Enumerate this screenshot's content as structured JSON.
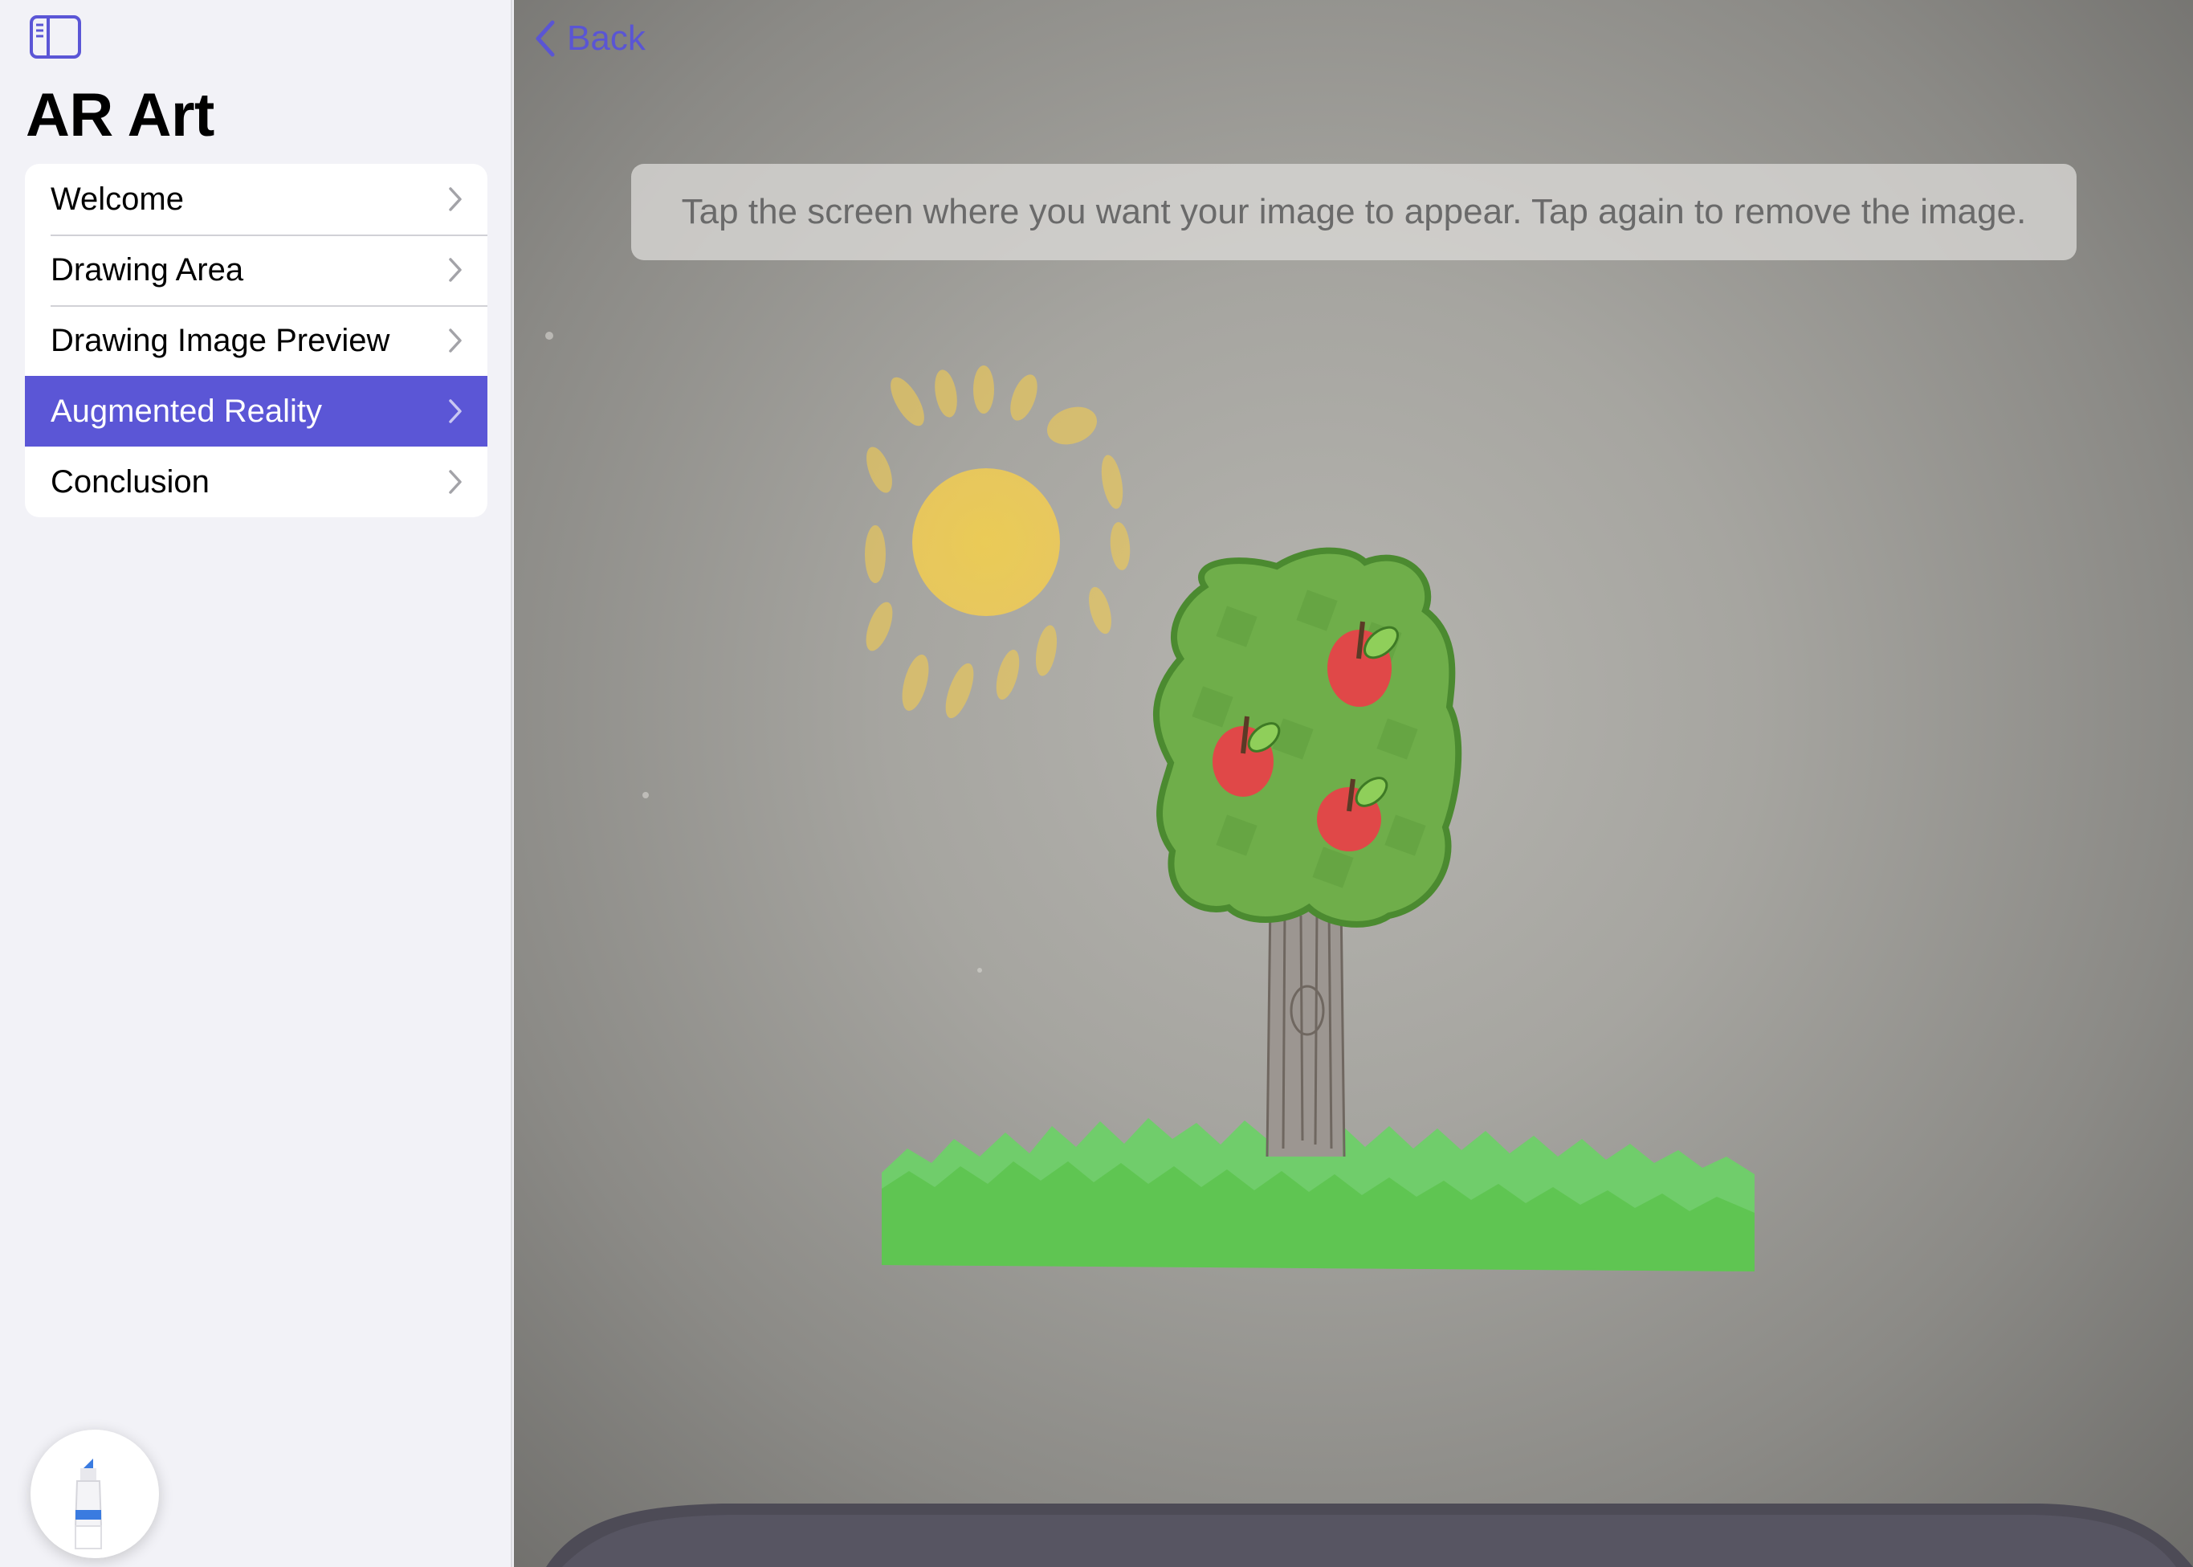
{
  "sidebar": {
    "title": "AR Art",
    "items": [
      {
        "label": "Welcome",
        "selected": false
      },
      {
        "label": "Drawing Area",
        "selected": false
      },
      {
        "label": "Drawing Image Preview",
        "selected": false
      },
      {
        "label": "Augmented Reality",
        "selected": true
      },
      {
        "label": "Conclusion",
        "selected": false
      }
    ],
    "toggle_icon": "sidebar-toggle-icon",
    "pen_icon": "marker-pen-icon"
  },
  "main": {
    "back_label": "Back",
    "hint": "Tap the screen where you want your image to appear. Tap again to remove the image.",
    "scene": "drawing-of-sun-and-apple-tree-on-grass"
  },
  "colors": {
    "accent": "#5b56d6",
    "sidebar_bg": "#f2f2f7",
    "selected_text": "#ffffff"
  }
}
